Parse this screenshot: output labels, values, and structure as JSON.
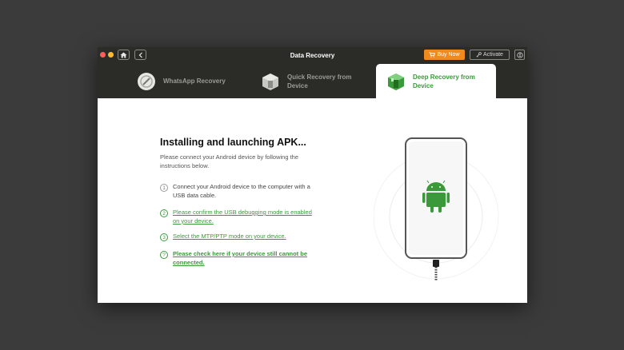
{
  "window": {
    "title": "Data Recovery",
    "buy_now": "Buy Now",
    "activate": "Activate"
  },
  "tabs": [
    {
      "label": "WhatsApp Recovery",
      "active": false
    },
    {
      "label": "Quick Recovery from Device",
      "active": false
    },
    {
      "label": "Deep Recovery from Device",
      "active": true
    }
  ],
  "main": {
    "heading": "Installing and launching APK...",
    "intro": "Please connect your Android device by following the instructions below.",
    "steps": [
      {
        "num": "1",
        "text": "Connect your Android device to the computer with a USB data cable."
      },
      {
        "num": "2",
        "text": "Please confirm the USB debugging mode is enabled on your device."
      },
      {
        "num": "3",
        "text": "Select the MTP/PTP mode on your device."
      },
      {
        "num": "?",
        "text": "Please check here if your device still cannot be connected."
      }
    ]
  },
  "colors": {
    "accent_green": "#3a9a3a",
    "buy_orange": "#f08a1c",
    "titlebar": "#2b2b28"
  },
  "icons": [
    "home-icon",
    "back-arrow-icon",
    "cart-icon",
    "key-icon",
    "menu-icon",
    "android-icon"
  ]
}
